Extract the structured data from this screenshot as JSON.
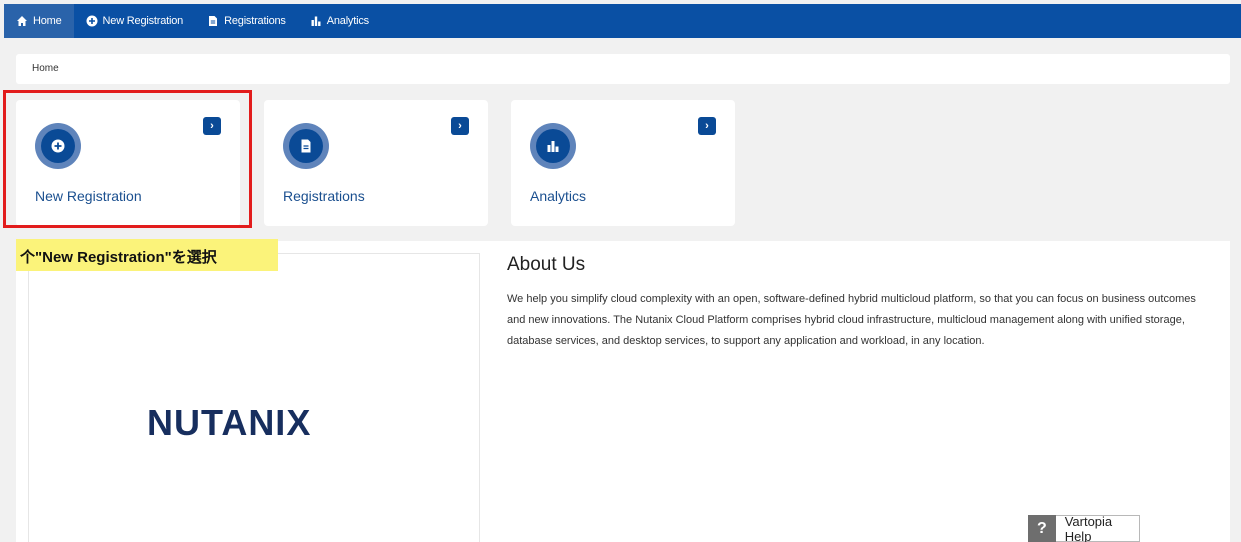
{
  "nav": {
    "items": [
      {
        "label": "Home",
        "icon": "home-icon",
        "active": true
      },
      {
        "label": "New Registration",
        "icon": "plus-circle-icon",
        "active": false
      },
      {
        "label": "Registrations",
        "icon": "document-icon",
        "active": false
      },
      {
        "label": "Analytics",
        "icon": "bar-chart-icon",
        "active": false
      }
    ]
  },
  "breadcrumb": {
    "current": "Home"
  },
  "cards": [
    {
      "label": "New Registration",
      "icon": "plus-circle-icon",
      "arrow": "›"
    },
    {
      "label": "Registrations",
      "icon": "document-icon",
      "arrow": "›"
    },
    {
      "label": "Analytics",
      "icon": "bar-chart-icon",
      "arrow": "›"
    }
  ],
  "annotation": {
    "text": "个\"New Registration\"を選択"
  },
  "logo": {
    "text": "NUTANIX"
  },
  "about": {
    "title": "About Us",
    "body": "We help you simplify cloud complexity with an open, software-defined hybrid multicloud platform, so that you can focus on business outcomes and new innovations. The Nutanix Cloud Platform comprises hybrid cloud infrastructure, multicloud management along with unified storage, database services, and desktop services, to support any application and workload, in any location."
  },
  "help": {
    "symbol": "?",
    "label": "Vartopia Help"
  },
  "colors": {
    "nav": "#0a50a4",
    "accent": "#0a4a96",
    "highlight": "#e21c1c",
    "note": "#fbf37a"
  }
}
